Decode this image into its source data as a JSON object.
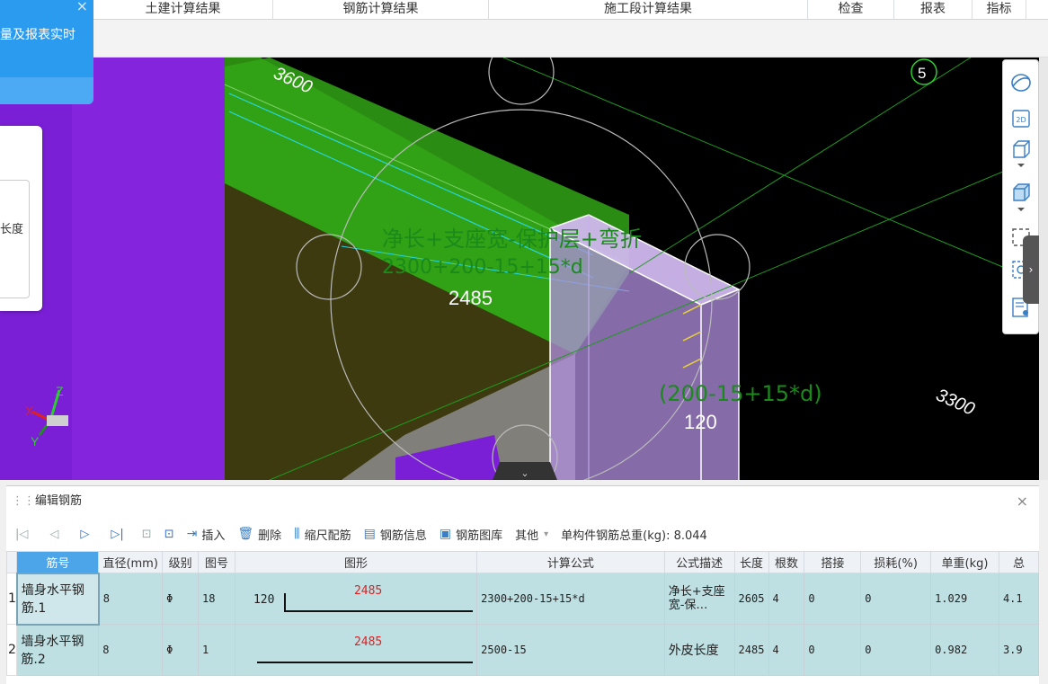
{
  "top_tabs": [
    {
      "label": "土建计算结果"
    },
    {
      "label": "钢筋计算结果"
    },
    {
      "label": "施工段计算结果"
    },
    {
      "label": "检查"
    },
    {
      "label": "报表"
    },
    {
      "label": "指标"
    }
  ],
  "notification": {
    "text": "量及报表实时",
    "close": "×"
  },
  "sidecard": {
    "label": "长度"
  },
  "viewport": {
    "labels": {
      "span_3600": "3600",
      "span_3300": "3300",
      "axis_5": "5",
      "formula_desc": "净长+支座宽-保护层+弯折",
      "formula": "2300+200-15+15*d",
      "length": "2485",
      "bend_formula": "(200-15+15*d)",
      "bend": "120",
      "axis_x": "X",
      "axis_y": "Y",
      "axis_z": "Z"
    }
  },
  "tools": [
    {
      "icon": "orbit-icon"
    },
    {
      "icon": "2d-view-icon",
      "label": "2D"
    },
    {
      "icon": "cube-view-icon"
    },
    {
      "icon": "cube-solid-icon"
    },
    {
      "icon": "box-select-icon"
    },
    {
      "icon": "visibility-icon"
    },
    {
      "icon": "properties-icon"
    }
  ],
  "panel": {
    "title": "编辑钢筋",
    "close": "×",
    "toolbar": {
      "insert": "插入",
      "delete": "删除",
      "scale_rebar": "缩尺配筋",
      "rebar_info": "钢筋信息",
      "rebar_library": "钢筋图库",
      "other": "其他",
      "total_weight": "单构件钢筋总重(kg): 8.044"
    },
    "columns": [
      "筋号",
      "直径(mm)",
      "级别",
      "图号",
      "图形",
      "计算公式",
      "公式描述",
      "长度",
      "根数",
      "搭接",
      "损耗(%)",
      "单重(kg)",
      "总"
    ],
    "rows": [
      {
        "index": "1",
        "name": "墙身水平钢筋.1",
        "diameter": "8",
        "grade": "Φ",
        "figure_no": "18",
        "shape_left": "120",
        "shape_len": "2485",
        "formula": "2300+200-15+15*d",
        "desc": "净长+支座宽-保…",
        "length": "2605",
        "count": "4",
        "lap": "0",
        "loss": "0",
        "unit_weight": "1.029",
        "total": "4.1"
      },
      {
        "index": "2",
        "name": "墙身水平钢筋.2",
        "diameter": "8",
        "grade": "Φ",
        "figure_no": "1",
        "shape_left": "",
        "shape_len": "2485",
        "formula": "2500-15",
        "desc": "外皮长度",
        "length": "2485",
        "count": "4",
        "lap": "0",
        "loss": "0",
        "unit_weight": "0.982",
        "total": "3.9"
      }
    ]
  }
}
